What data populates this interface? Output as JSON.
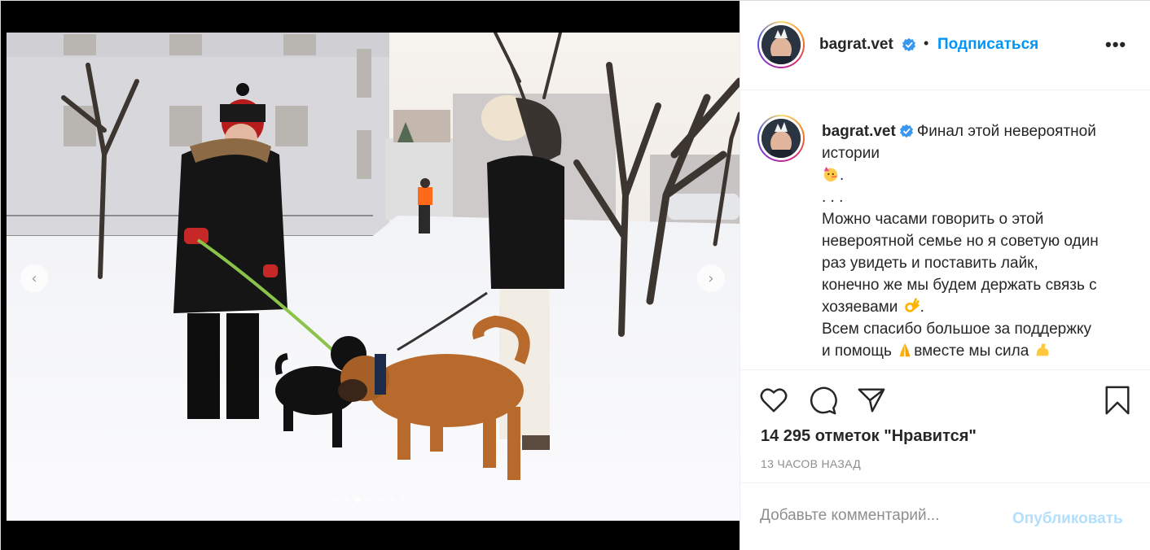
{
  "post": {
    "username": "bagrat.vet",
    "follow_label": "Подписаться",
    "bullet": "•",
    "more_label": "•••",
    "caption_lines": [
      "Финал этой невероятной",
      "истории",
      ". . .",
      "Можно часами говорить о этой",
      "невероятной семье но я советую один",
      "раз увидеть и поставить лайк,",
      "конечно же мы будем держать связь с",
      "хозяевами",
      "Всем спасибо большое за поддержку",
      "и помощь",
      "вместе мы сила"
    ],
    "likes_text": "14 295 отметок \"Нравится\"",
    "time_text": "13 ЧАСОВ НАЗАД",
    "comment_placeholder": "Добавьте комментарий...",
    "publish_label": "Опубликовать"
  },
  "carousel": {
    "prev_label": "‹",
    "next_label": "›",
    "slide_count": 7,
    "active_slide": 3
  },
  "icons": {
    "like": "heart-icon",
    "comment": "comment-icon",
    "share": "share-icon",
    "save": "bookmark-icon",
    "verified": "verified-badge-icon"
  },
  "colors": {
    "link": "#0095f6",
    "publish_disabled": "#b2dffc",
    "muted": "#8e8e8e",
    "text": "#262626"
  }
}
